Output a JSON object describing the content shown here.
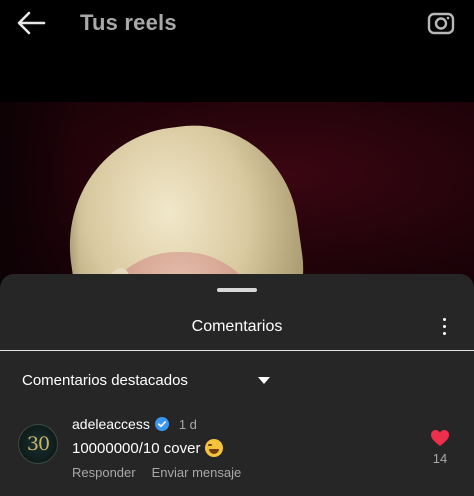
{
  "header": {
    "title": "Tus reels",
    "back_icon": "arrow-left-icon",
    "camera_icon": "camera-icon"
  },
  "sheet": {
    "title": "Comentarios",
    "filter_label": "Comentarios destacados"
  },
  "comment": {
    "avatar_text": "30",
    "username": "adeleaccess",
    "verified": true,
    "time": "1 d",
    "text": "10000000/10 cover",
    "emoji": "laughing-tears-emoji",
    "reply_label": "Responder",
    "message_label": "Enviar mensaje",
    "like_count": "14",
    "liked": true
  },
  "colors": {
    "sheet_bg": "#262626",
    "like_red": "#ed2f4c",
    "verified_blue": "#3897f0"
  }
}
